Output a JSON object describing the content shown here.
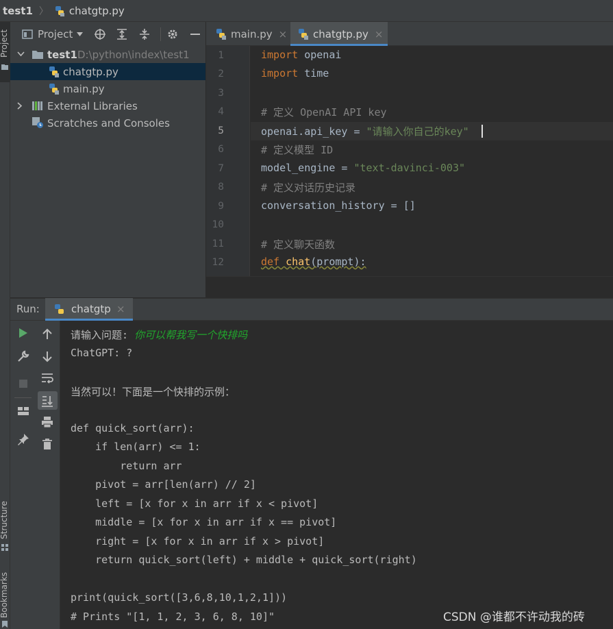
{
  "navbar": {
    "project": "test1",
    "file": "chatgtp.py"
  },
  "left_strip": {
    "project_label": "Project",
    "structure_label": "Structure",
    "bookmarks_label": "Bookmarks"
  },
  "project_panel": {
    "title": "Project",
    "tree": [
      {
        "label": "test1",
        "path": "D:\\python\\index\\test1"
      },
      {
        "label": "chatgtp.py"
      },
      {
        "label": "main.py"
      },
      {
        "label": "External Libraries"
      },
      {
        "label": "Scratches and Consoles"
      }
    ]
  },
  "editor": {
    "tabs": [
      {
        "label": "main.py"
      },
      {
        "label": "chatgtp.py"
      }
    ],
    "close_glyph": "×",
    "line_numbers": [
      "1",
      "2",
      "3",
      "4",
      "5",
      "6",
      "7",
      "8",
      "9",
      "10",
      "11",
      "12"
    ],
    "code": {
      "l1_kw": "import",
      "l1_rest": " openai",
      "l2_kw": "import",
      "l2_rest": " time",
      "l4": "# 定义 OpenAI API key",
      "l5_a": "openai.api_key = ",
      "l5_str": "\"请输入你自己的key\"",
      "l6": "# 定义模型 ID",
      "l7_a": "model_engine = ",
      "l7_str": "\"text-davinci-003\"",
      "l8": "# 定义对话历史记录",
      "l9": "conversation_history = []",
      "l11": "# 定义聊天函数",
      "l12_kw": "def",
      "l12_fn": "chat",
      "l12_rest": "(prompt):"
    }
  },
  "run": {
    "label": "Run:",
    "tab_label": "chatgtp",
    "console": {
      "prompt_label": "请输入问题: ",
      "user_input": "你可以帮我写一个快排吗",
      "lines": [
        "ChatGPT: ?",
        "",
        "当然可以！下面是一个快排的示例：",
        "",
        "def quick_sort(arr):",
        "    if len(arr) <= 1:",
        "        return arr",
        "    pivot = arr[len(arr) // 2]",
        "    left = [x for x in arr if x < pivot]",
        "    middle = [x for x in arr if x == pivot]",
        "    right = [x for x in arr if x > pivot]",
        "    return quick_sort(left) + middle + quick_sort(right)",
        "",
        "print(quick_sort([3,6,8,10,1,2,1]))",
        "# Prints \"[1, 1, 2, 3, 6, 8, 10]\""
      ]
    }
  },
  "watermark": "CSDN @谁都不许动我的砖",
  "colors": {
    "keyword": "#cc7832",
    "string": "#6a8759",
    "comment": "#808080",
    "function": "#ffc66d",
    "user_input": "#21a62c",
    "selection": "#0d293e",
    "tab_underline": "#4a88c7"
  }
}
